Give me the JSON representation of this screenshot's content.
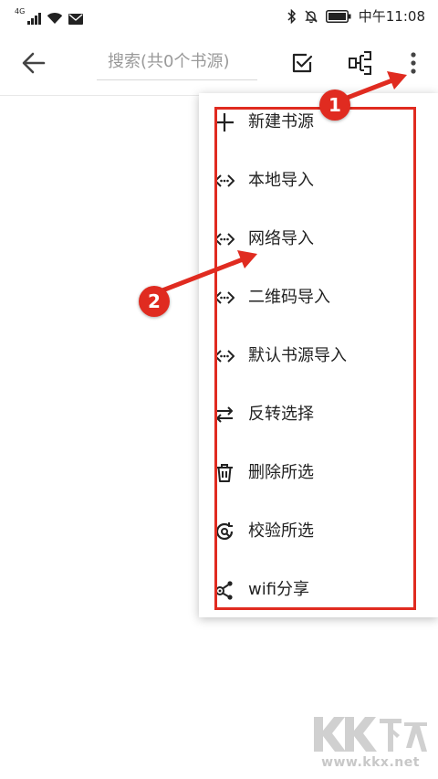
{
  "status_bar": {
    "network": "4G",
    "time": "中午11:08"
  },
  "toolbar": {
    "search_placeholder": "搜索(共0个书源)"
  },
  "menu": {
    "items": [
      {
        "label": "新建书源",
        "icon": "plus-icon"
      },
      {
        "label": "本地导入",
        "icon": "code-arrows-icon"
      },
      {
        "label": "网络导入",
        "icon": "code-arrows-icon"
      },
      {
        "label": "二维码导入",
        "icon": "code-arrows-icon"
      },
      {
        "label": "默认书源导入",
        "icon": "code-arrows-icon"
      },
      {
        "label": "反转选择",
        "icon": "swap-arrows-icon"
      },
      {
        "label": "删除所选",
        "icon": "trash-icon"
      },
      {
        "label": "校验所选",
        "icon": "check-refresh-icon"
      },
      {
        "label": "wifi分享",
        "icon": "share-nodes-icon"
      }
    ]
  },
  "annotations": {
    "step1": "1",
    "step2": "2",
    "color": "#e02b20"
  },
  "watermark": {
    "logo": "KK下载",
    "url": "www.kkx.net"
  }
}
